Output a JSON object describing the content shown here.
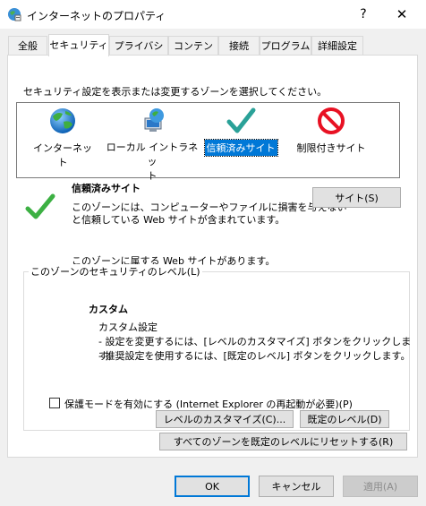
{
  "window": {
    "title": "インターネットのプロパティ",
    "help_glyph": "?",
    "close_glyph": "✕"
  },
  "tabs": [
    {
      "label": "全般"
    },
    {
      "label": "セキュリティ"
    },
    {
      "label": "プライバシー"
    },
    {
      "label": "コンテンツ"
    },
    {
      "label": "接続"
    },
    {
      "label": "プログラム"
    },
    {
      "label": "詳細設定"
    }
  ],
  "security": {
    "instruction": "セキュリティ設定を表示または変更するゾーンを選択してください。",
    "zones": [
      {
        "label": "インターネット",
        "icon": "globe-icon"
      },
      {
        "label": "ローカル イントラネット",
        "label_line1": "ローカル イントラネッ",
        "label_line2": "ト",
        "icon": "intranet-icon"
      },
      {
        "label": "信頼済みサイト",
        "icon": "checkmark-icon",
        "selected": true
      },
      {
        "label": "制限付きサイト",
        "icon": "restricted-icon"
      }
    ],
    "zone_title": "信頼済みサイト",
    "zone_desc_line1": "このゾーンには、コンピューターやファイルに損害を与えない",
    "zone_desc_line2": "と信頼している Web サイトが含まれています。",
    "sites_button": "サイト(S)",
    "zone_status": "このゾーンに属する Web サイトがあります。",
    "level_group_label": "このゾーンのセキュリティのレベル(L)",
    "level_name": "カスタム",
    "level_line1": "カスタム設定",
    "level_line2": "- 設定を変更するには、[レベルのカスタマイズ] ボタンをクリックします。",
    "level_line3": "- 推奨設定を使用するには、[既定のレベル] ボタンをクリックします。",
    "protected_mode_label": "保護モードを有効にする (Internet Explorer の再起動が必要)(P)",
    "protected_mode_checked": false,
    "customize_button": "レベルのカスタマイズ(C)...",
    "default_level_button": "既定のレベル(D)",
    "reset_all_button": "すべてのゾーンを既定のレベルにリセットする(R)"
  },
  "footer": {
    "ok": "OK",
    "cancel": "キャンセル",
    "apply": "適用(A)"
  },
  "colors": {
    "selection": "#0078d7",
    "check_green": "#3cb043",
    "restricted_red": "#e81123"
  }
}
